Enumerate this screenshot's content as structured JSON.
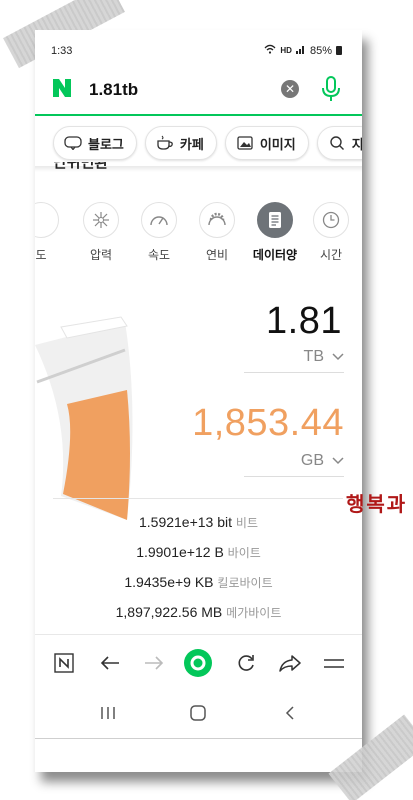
{
  "status_bar": {
    "time": "1:33",
    "indicators": "HD",
    "battery": "85%"
  },
  "search": {
    "query": "1.81tb",
    "clear_icon": "clear-icon",
    "voice_icon": "mic-icon",
    "accent": "#03c75a"
  },
  "chips": [
    {
      "label": "블로그",
      "icon": "blog-icon"
    },
    {
      "label": "카페",
      "icon": "cafe-icon"
    },
    {
      "label": "이미지",
      "icon": "image-icon"
    },
    {
      "label": "지",
      "icon": "search-icon"
    }
  ],
  "converter": {
    "section_title": "단위변환",
    "units": [
      "도",
      "압력",
      "속도",
      "연비",
      "데이터양",
      "시간"
    ],
    "active_unit": "데이터양",
    "input_value": "1.81",
    "input_unit": "TB",
    "output_value": "1,853.44",
    "output_unit": "GB",
    "output_color": "#f0a060",
    "results": [
      {
        "value": "1.5921e+13",
        "unit": "bit",
        "korean": "비트"
      },
      {
        "value": "1.9901e+12",
        "unit": "B",
        "korean": "바이트"
      },
      {
        "value": "1.9435e+9",
        "unit": "KB",
        "korean": "킬로바이트"
      },
      {
        "value": "1,897,922.56",
        "unit": "MB",
        "korean": "메가바이트"
      }
    ]
  },
  "watermark": "행복과"
}
